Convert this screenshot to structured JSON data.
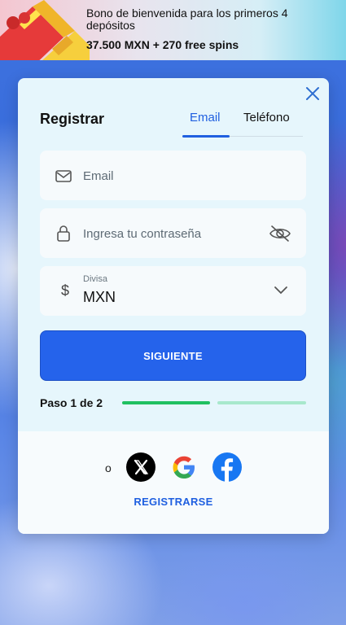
{
  "banner": {
    "title": "Bono de bienvenida para los primeros 4 depósitos",
    "bonus": "37.500 MXN + 270 free spins"
  },
  "form": {
    "title": "Registrar",
    "tabs": [
      {
        "label": "Email",
        "active": true
      },
      {
        "label": "Teléfono",
        "active": false
      }
    ],
    "email_placeholder": "Email",
    "password_placeholder": "Ingresa tu contraseña",
    "currency": {
      "symbol": "$",
      "label": "Divisa",
      "value": "MXN"
    },
    "next_label": "SIGUIENTE",
    "step_text": "Paso 1 de 2",
    "step_progress": 0.5
  },
  "footer": {
    "or_text": "o",
    "social": [
      {
        "name": "x-icon"
      },
      {
        "name": "google-icon"
      },
      {
        "name": "facebook-icon"
      }
    ],
    "register_label": "REGISTRARSE"
  },
  "colors": {
    "accent": "#2563eb",
    "progress_done": "#20c060",
    "progress_todo": "#a8e8cc",
    "modal_bg": "#e6f6fc"
  }
}
